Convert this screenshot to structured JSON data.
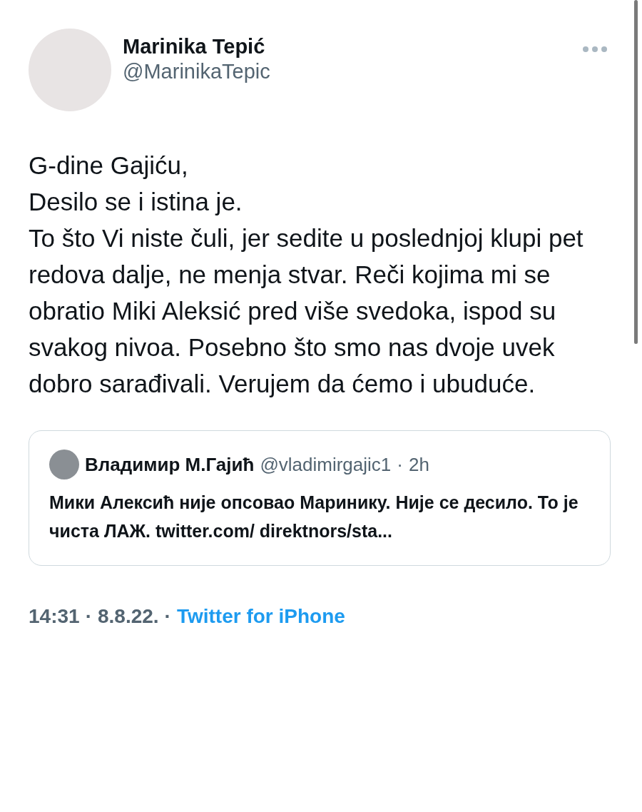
{
  "author": {
    "name": "Marinika Tepić",
    "handle": "@MarinikaTepic"
  },
  "tweet_lines": [
    "G-dine Gajiću,",
    "Desilo se i istina je.",
    "To što Vi niste čuli, jer sedite u poslednjoj klupi pet redova dalje, ne menja stvar. Reči kojima mi se obratio Miki Aleksić pred više svedoka, ispod su svakog nivoa. Posebno što smo nas dvoje uvek dobro sarađivali. Verujem da ćemo i ubuduće."
  ],
  "quoted_tweet": {
    "name": "Владимир М.Гајић",
    "handle": "@vladimirgajic1",
    "separator": "·",
    "time": "2h",
    "text": "Мики Алексић није опсовао Маринику. Није се десило. То је чиста ЛАЖ. twitter.com/ direktnors/sta..."
  },
  "footer": {
    "time": "14:31",
    "separator_1": "·",
    "date": "8.8.22.",
    "separator_2": "·",
    "source": "Twitter for iPhone"
  }
}
